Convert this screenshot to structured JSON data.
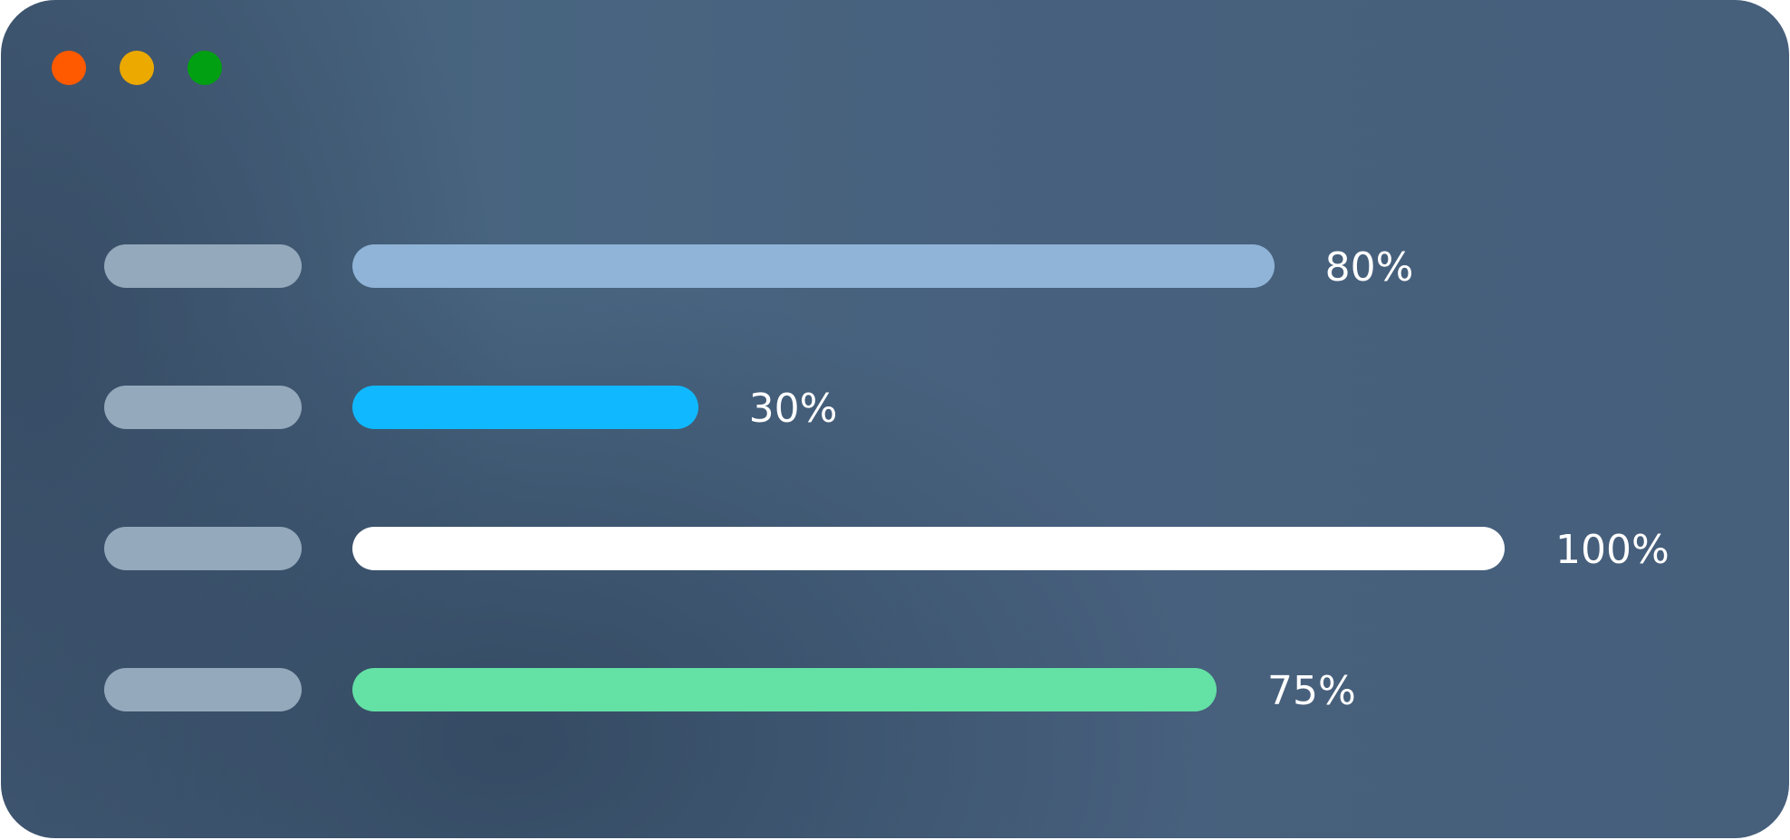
{
  "window": {
    "controls": [
      {
        "name": "close",
        "color": "#ff5a00"
      },
      {
        "name": "minimize",
        "color": "#eca900"
      },
      {
        "name": "maximize",
        "color": "#00a012"
      }
    ]
  },
  "chart_data": {
    "type": "bar",
    "orientation": "horizontal",
    "categories": [
      "",
      "",
      "",
      ""
    ],
    "values": [
      80,
      30,
      100,
      75
    ],
    "value_labels": [
      "80%",
      "30%",
      "100%",
      "75%"
    ],
    "colors": [
      "#8fb4d7",
      "#10b9ff",
      "#ffffff",
      "#64e1a5"
    ],
    "xlim": [
      0,
      100
    ],
    "grid": false,
    "legend": "none"
  }
}
